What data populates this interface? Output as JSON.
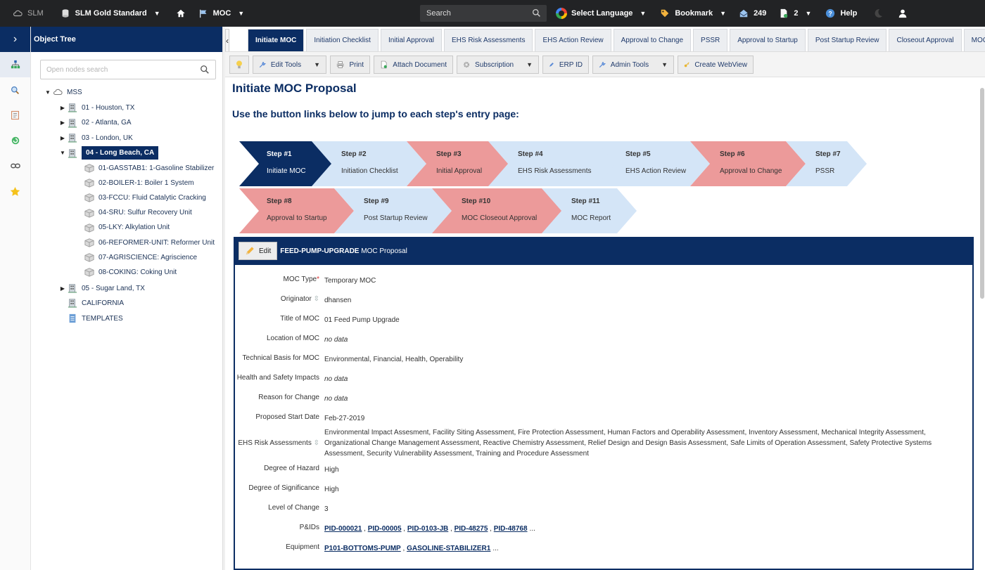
{
  "topbar": {
    "app_name": "SLM",
    "database": "SLM Gold Standard",
    "module": "MOC",
    "search_label": "Search",
    "language": "Select Language",
    "bookmark": "Bookmark",
    "inbox_count": "249",
    "docs_count": "2",
    "help": "Help"
  },
  "sidebar": {
    "title": "Object Tree",
    "search_placeholder": "Open nodes search",
    "rail_icons": [
      "tree-icon",
      "search-icon",
      "notebook-icon",
      "refresh-icon",
      "link-icon",
      "star-icon"
    ]
  },
  "tree": {
    "root": "MSS",
    "sites": [
      "01 - Houston, TX",
      "02 - Atlanta, GA",
      "03 - London, UK",
      "04 - Long Beach, CA"
    ],
    "units": [
      "01-GASSTAB1: 1-Gasoline Stabilizer",
      "02-BOILER-1: Boiler 1 System",
      "03-FCCU: Fluid Catalytic Cracking",
      "04-SRU: Sulfur Recovery Unit",
      "05-LKY: Alkylation Unit",
      "06-REFORMER-UNIT: Reformer Unit",
      "07-AGRISCIENCE: Agriscience",
      "08-COKING: Coking Unit"
    ],
    "after": [
      "05 - Sugar Land, TX",
      "CALIFORNIA",
      "TEMPLATES"
    ]
  },
  "tabs": [
    "Initiate MOC",
    "Initiation Checklist",
    "Initial Approval",
    "EHS Risk Assessments",
    "EHS Action Review",
    "Approval to Change",
    "PSSR",
    "Approval to Startup",
    "Post Startup Review",
    "Closeout Approval",
    "MOC Rep"
  ],
  "toolbar": {
    "edit_tools": "Edit Tools",
    "print": "Print",
    "attach": "Attach Document",
    "subscription": "Subscription",
    "erp": "ERP ID",
    "admin": "Admin Tools",
    "webview": "Create WebView"
  },
  "page": {
    "title": "Initiate MOC Proposal",
    "instructions": "Use the button links below to jump to each step's entry page:"
  },
  "steps": [
    {
      "num": "Step #1",
      "label": "Initiate MOC"
    },
    {
      "num": "Step #2",
      "label": "Initiation Checklist"
    },
    {
      "num": "Step #3",
      "label": "Initial Approval"
    },
    {
      "num": "Step #4",
      "label": "EHS Risk Assessments"
    },
    {
      "num": "Step #5",
      "label": "EHS Action Review"
    },
    {
      "num": "Step #6",
      "label": "Approval to Change"
    },
    {
      "num": "Step #7",
      "label": "PSSR"
    },
    {
      "num": "Step #8",
      "label": "Approval to Startup"
    },
    {
      "num": "Step #9",
      "label": "Post Startup Review"
    },
    {
      "num": "Step #10",
      "label": "MOC Closeout Approval"
    },
    {
      "num": "Step #11",
      "label": "MOC Report"
    }
  ],
  "colors": {
    "navy": "#0b2d63",
    "light": "#d4e5f7",
    "red": "#ec9a9a"
  },
  "form": {
    "edit_label": "Edit",
    "object_name": "FEED-PUMP-UPGRADE",
    "object_type": "MOC Proposal",
    "fields": {
      "moc_type": {
        "label": "MOC Type",
        "value": "Temporary MOC"
      },
      "originator": {
        "label": "Originator",
        "value": "dhansen"
      },
      "title": {
        "label": "Title of MOC",
        "value": "01 Feed Pump Upgrade"
      },
      "location": {
        "label": "Location of MOC",
        "value": "no data"
      },
      "basis": {
        "label": "Technical Basis for MOC",
        "value": "Environmental, Financial, Health, Operability"
      },
      "hs_impacts": {
        "label": "Health and Safety Impacts",
        "value": "no data"
      },
      "reason": {
        "label": "Reason for Change",
        "value": "no data"
      },
      "start_date": {
        "label": "Proposed Start Date",
        "value": "Feb-27-2019"
      },
      "ehs": {
        "label": "EHS Risk Assessments",
        "value": "Environmental Impact Assesment, Facility Siting Assessment, Fire Protection Assessment, Human Factors and Operability Assessment, Inventory Assessment, Mechanical Integrity Assessment, Organizational Change Management Assessment, Reactive Chemistry Assessment, Relief Design and Design Basis Assessment, Safe Limits of Operation Assessment, Safety Protective Systems Assessment, Security Vulnerability Assessment, Training and Procedure Assessment"
      },
      "hazard": {
        "label": "Degree of Hazard",
        "value": "High"
      },
      "significance": {
        "label": "Degree of Significance",
        "value": "High"
      },
      "level": {
        "label": "Level of Change",
        "value": "3"
      },
      "pids": {
        "label": "P&IDs",
        "links": [
          "PID-000021",
          "PID-00005",
          "PID-0103-JB",
          "PID-48275",
          "PID-48768"
        ],
        "more": "..."
      },
      "equipment": {
        "label": "Equipment",
        "links": [
          "P101-BOTTOMS-PUMP",
          "GASOLINE-STABILIZER1"
        ],
        "more": "..."
      }
    }
  }
}
